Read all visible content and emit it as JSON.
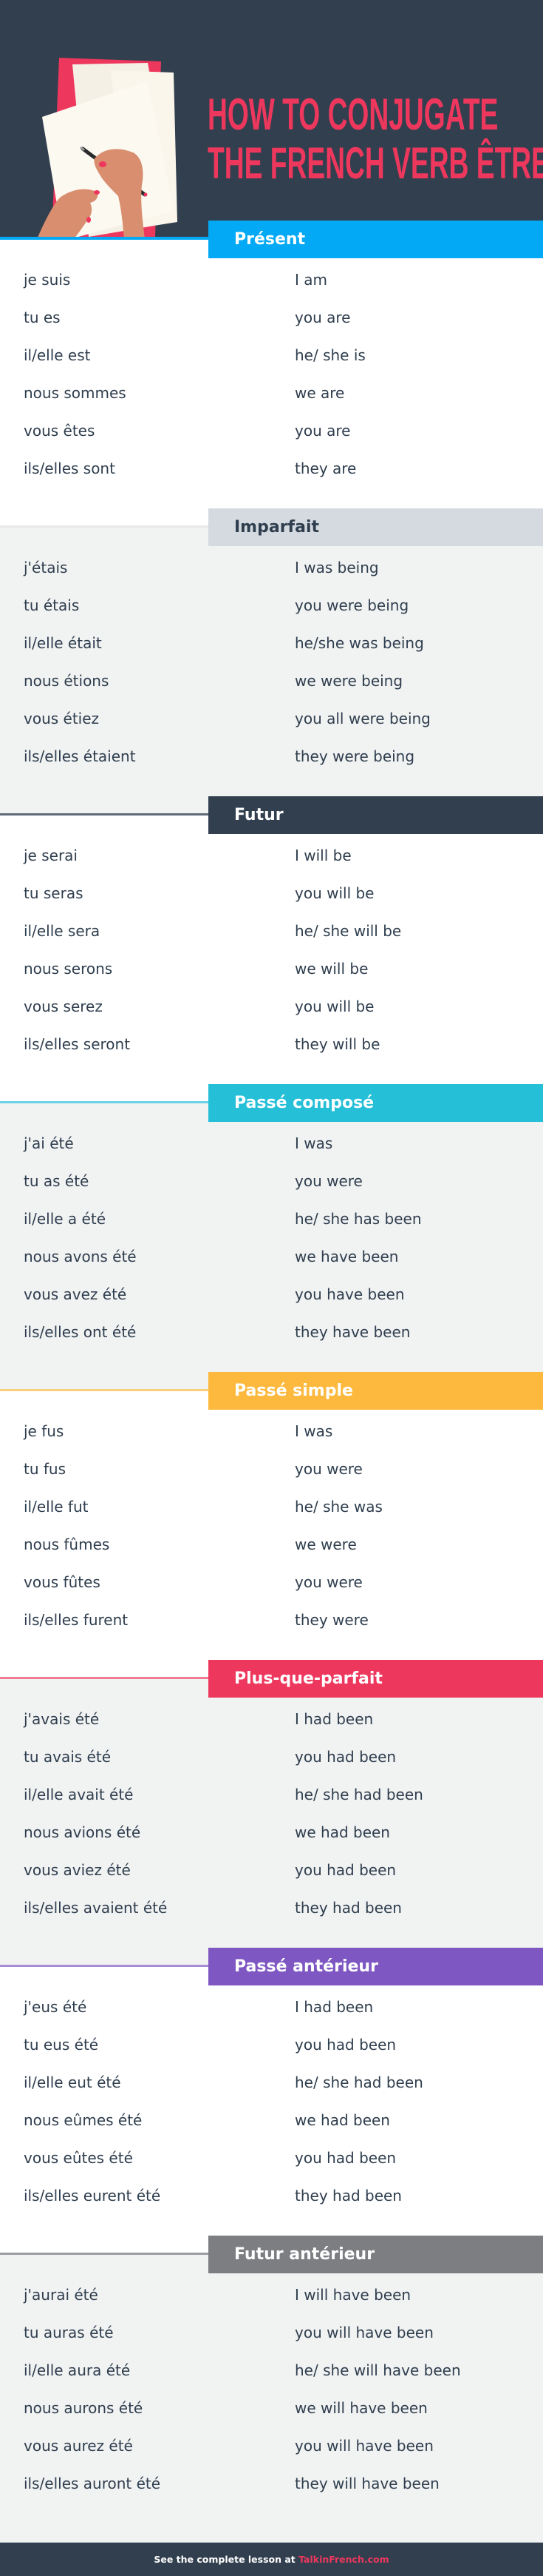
{
  "hero": {
    "title_line1": "HOW TO CONJUGATE",
    "title_line2": "THE FRENCH VERB ÊTRE",
    "illustration": "hand-writing-on-paper-illustration",
    "title_color": "#ee375d",
    "background_color": "#323f4f"
  },
  "sections": [
    {
      "title": "Présent",
      "band_color": "#03a9f4",
      "band_text_color": "#ffffff",
      "line_color": "#03a9f4",
      "background": "#ffffff",
      "rows": [
        {
          "fr": "je suis",
          "en": "I am"
        },
        {
          "fr": "tu es",
          "en": "you are"
        },
        {
          "fr": "il/elle est",
          "en": "he/ she is"
        },
        {
          "fr": "nous sommes",
          "en": "we are"
        },
        {
          "fr": "vous êtes",
          "en": "you are"
        },
        {
          "fr": "ils/elles sont",
          "en": "they are"
        }
      ]
    },
    {
      "title": "Imparfait",
      "band_color": "#d5dae0",
      "band_text_color": "#2f3e4e",
      "line_color": "#e6e8ea",
      "background": "#f1f2f2",
      "rows": [
        {
          "fr": "j'étais",
          "en": "I was being"
        },
        {
          "fr": "tu étais",
          "en": "you were being"
        },
        {
          "fr": "il/elle était",
          "en": "he/she was being"
        },
        {
          "fr": "nous étions",
          "en": "we were being"
        },
        {
          "fr": "vous étiez",
          "en": "you all were being"
        },
        {
          "fr": "ils/elles étaient",
          "en": "they were being"
        }
      ]
    },
    {
      "title": "Futur",
      "band_color": "#323f4f",
      "band_text_color": "#ffffff",
      "line_color": "#5f6b79",
      "background": "#ffffff",
      "rows": [
        {
          "fr": "je serai",
          "en": "I will be"
        },
        {
          "fr": "tu seras",
          "en": "you will be"
        },
        {
          "fr": "il/elle sera",
          "en": "he/ she will be"
        },
        {
          "fr": "nous serons",
          "en": "we will be"
        },
        {
          "fr": "vous serez",
          "en": "you will be"
        },
        {
          "fr": "ils/elles seront",
          "en": "they will be"
        }
      ]
    },
    {
      "title": "Passé composé",
      "band_color": "#25bfd8",
      "band_text_color": "#ffffff",
      "line_color": "#6dd3e4",
      "background": "#f1f2f2",
      "rows": [
        {
          "fr": "j'ai été",
          "en": "I was"
        },
        {
          "fr": "tu as été",
          "en": "you were"
        },
        {
          "fr": "il/elle a été",
          "en": "he/ she has been"
        },
        {
          "fr": "nous avons été",
          "en": "we have been"
        },
        {
          "fr": "vous avez été",
          "en": "you have been"
        },
        {
          "fr": "ils/elles ont été",
          "en": "they have been"
        }
      ]
    },
    {
      "title": "Passé simple",
      "band_color": "#fdb93d",
      "band_text_color": "#ffffff",
      "line_color": "#fdcf7a",
      "background": "#ffffff",
      "rows": [
        {
          "fr": "je fus",
          "en": "I was"
        },
        {
          "fr": "tu fus",
          "en": "you were"
        },
        {
          "fr": "il/elle fut",
          "en": "he/ she was"
        },
        {
          "fr": "nous fûmes",
          "en": "we were"
        },
        {
          "fr": "vous fûtes",
          "en": "you were"
        },
        {
          "fr": "ils/elles furent",
          "en": "they were"
        }
      ]
    },
    {
      "title": "Plus-que-parfait",
      "band_color": "#ee375d",
      "band_text_color": "#ffffff",
      "line_color": "#f27a93",
      "background": "#f1f2f2",
      "rows": [
        {
          "fr": "j'avais été",
          "en": "I had been"
        },
        {
          "fr": "tu avais été",
          "en": "you had been"
        },
        {
          "fr": "il/elle avait été",
          "en": "he/ she had been"
        },
        {
          "fr": "nous avions été",
          "en": "we had been"
        },
        {
          "fr": "vous aviez été",
          "en": "you had been"
        },
        {
          "fr": "ils/elles avaient été",
          "en": "they had been"
        }
      ]
    },
    {
      "title": "Passé antérieur",
      "band_color": "#7e57c2",
      "band_text_color": "#ffffff",
      "line_color": "#a68bd6",
      "background": "#ffffff",
      "rows": [
        {
          "fr": "j'eus été",
          "en": "I had been"
        },
        {
          "fr": "tu eus été",
          "en": "you had been"
        },
        {
          "fr": "il/elle eut été",
          "en": "he/ she had been"
        },
        {
          "fr": "nous eûmes été",
          "en": "we had been"
        },
        {
          "fr": "vous eûtes été",
          "en": "you had been"
        },
        {
          "fr": "ils/elles eurent été",
          "en": "they had been"
        }
      ]
    },
    {
      "title": "Futur antérieur",
      "band_color": "#7c7e82",
      "band_text_color": "#ffffff",
      "line_color": "#9a9ca0",
      "background": "#f1f2f2",
      "rows": [
        {
          "fr": "j'aurai été",
          "en": "I will have been"
        },
        {
          "fr": "tu auras été",
          "en": "you will have been"
        },
        {
          "fr": "il/elle aura été",
          "en": "he/ she will have been"
        },
        {
          "fr": "nous aurons été",
          "en": "we will have been"
        },
        {
          "fr": "vous aurez été",
          "en": "you will have been"
        },
        {
          "fr": "ils/elles auront été",
          "en": "they will have been"
        }
      ]
    }
  ],
  "footer": {
    "text": "See the complete lesson at ",
    "link_text": "TalkinFrench.com",
    "link_color": "#ee375d"
  }
}
